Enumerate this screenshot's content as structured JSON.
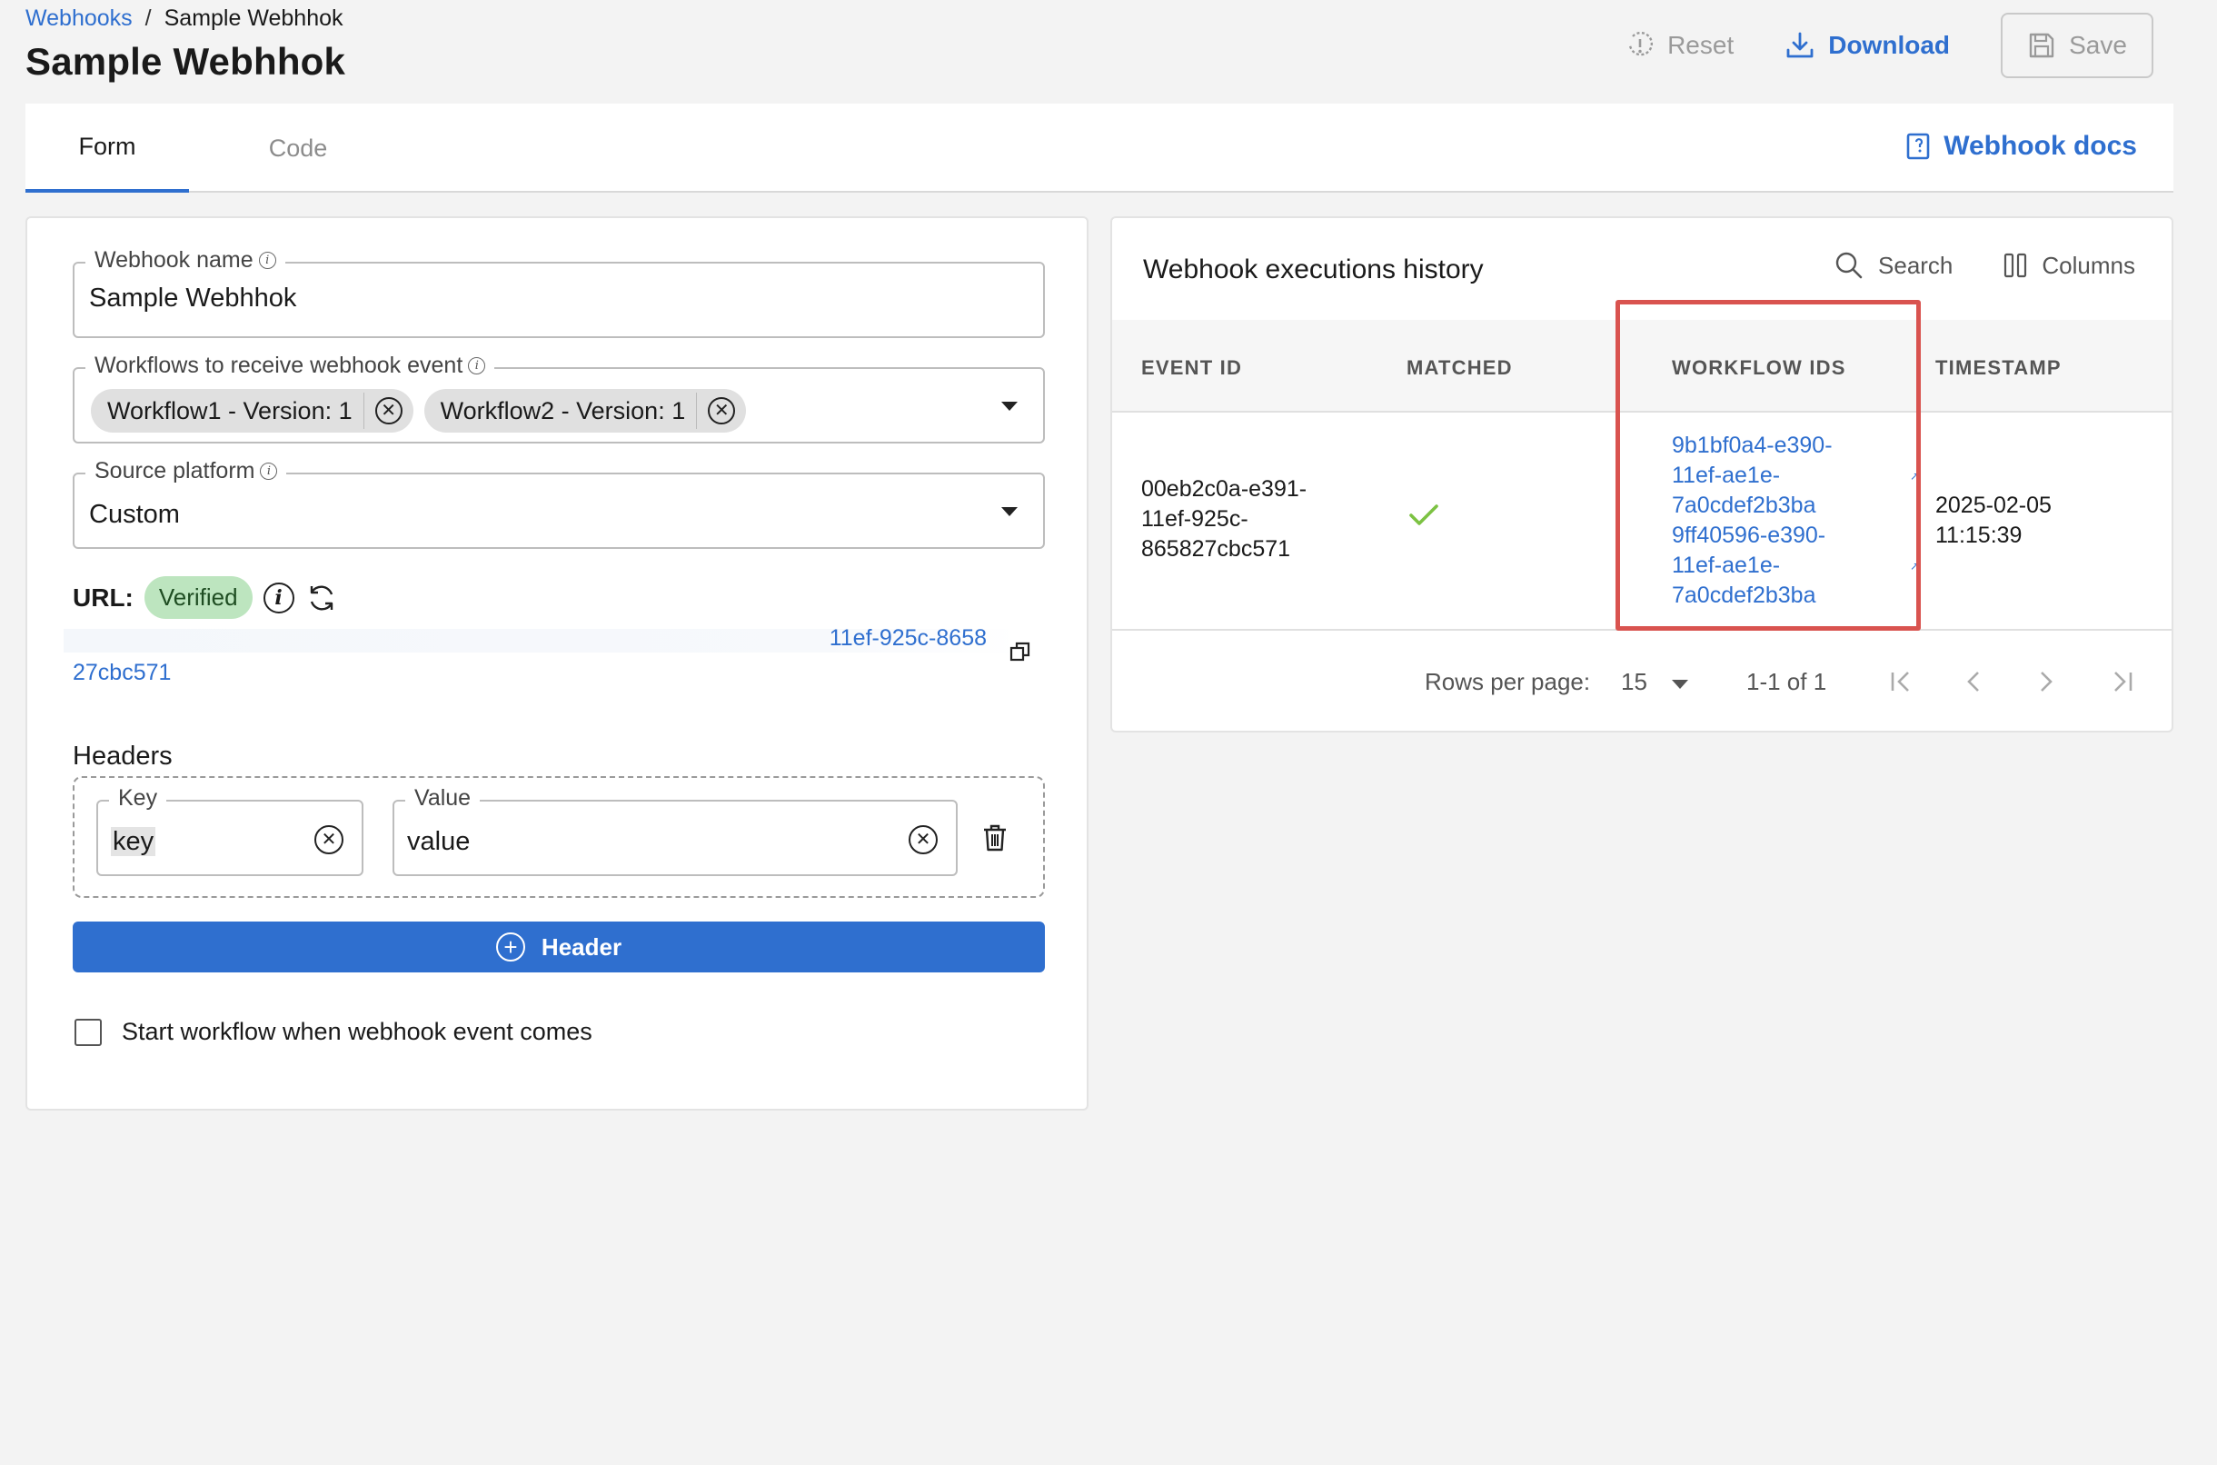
{
  "breadcrumb": {
    "parent": "Webhooks",
    "separator": "/",
    "current": "Sample Webhhok"
  },
  "page": {
    "title": "Sample Webhhok"
  },
  "toolbar": {
    "reset_label": "Reset",
    "download_label": "Download",
    "save_label": "Save"
  },
  "tabs": [
    {
      "label": "Form",
      "active": true
    },
    {
      "label": "Code",
      "active": false
    }
  ],
  "docs_link": "Webhook docs",
  "form": {
    "webhook_name": {
      "label": "Webhook name",
      "value": "Sample Webhhok"
    },
    "workflows": {
      "label": "Workflows to receive webhook event",
      "chips": [
        "Workflow1 - Version: 1",
        "Workflow2 - Version: 1"
      ]
    },
    "source_platform": {
      "label": "Source platform",
      "value": "Custom"
    },
    "url": {
      "label": "URL:",
      "status": "Verified",
      "value_line1": "11ef-925c-8658",
      "value_line2": "27cbc571"
    },
    "headers": {
      "title": "Headers",
      "key_label": "Key",
      "key_value": "key",
      "value_label": "Value",
      "value_value": "value"
    },
    "add_header_label": "Header",
    "start_workflow_label": "Start workflow when webhook event comes",
    "start_workflow_checked": false
  },
  "history": {
    "title": "Webhook executions history",
    "search_label": "Search",
    "columns_label": "Columns",
    "headers": [
      "EVENT ID",
      "MATCHED",
      "WORKFLOW IDS",
      "TIMESTAMP"
    ],
    "rows": [
      {
        "event_id_lines": [
          "00eb2c0a-e391-",
          "11ef-925c-",
          "865827cbc571"
        ],
        "matched": true,
        "workflow_ids": [
          [
            "9b1bf0a4-e390-",
            "11ef-ae1e-",
            "7a0cdef2b3ba"
          ],
          [
            "9ff40596-e390-",
            "11ef-ae1e-",
            "7a0cdef2b3ba"
          ]
        ],
        "timestamp_lines": [
          "2025-02-05",
          "11:15:39"
        ]
      }
    ],
    "pagination": {
      "rows_per_page_label": "Rows per page:",
      "rows_per_page": "15",
      "range": "1-1 of 1"
    }
  },
  "colors": {
    "accent": "#2f6fcf",
    "verified_bg": "#bde5bf",
    "highlight": "#d9534f",
    "check": "#7cc242"
  }
}
